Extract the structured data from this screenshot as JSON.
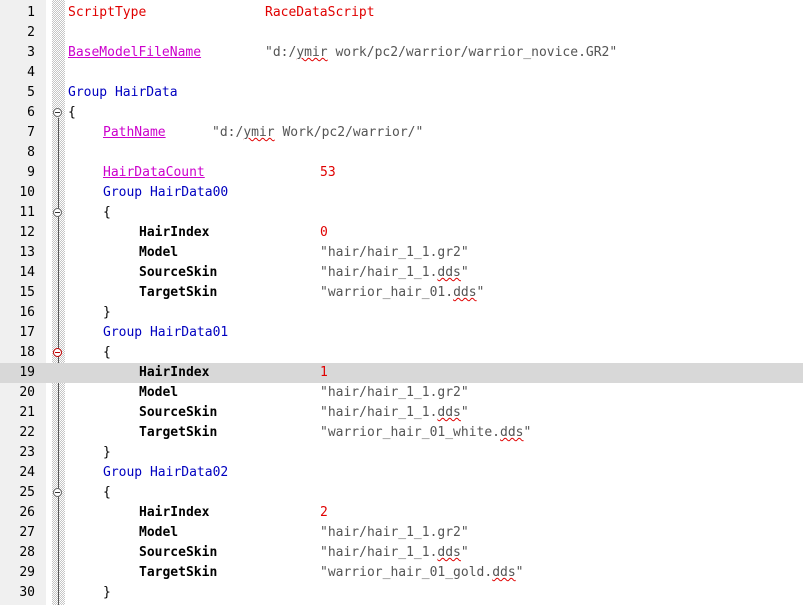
{
  "editor": {
    "lines": [
      {
        "n": "1",
        "key": "ScriptType",
        "val": "RaceDataScript"
      },
      {
        "n": "2"
      },
      {
        "n": "3",
        "key": "BaseModelFileName",
        "val_pre": "\"d:/",
        "val_sq": "ymir",
        "val_post": " work/pc2/warrior/warrior_novice.GR2\""
      },
      {
        "n": "4"
      },
      {
        "n": "5",
        "text": "Group HairData"
      },
      {
        "n": "6",
        "text": "{"
      },
      {
        "n": "7",
        "key": "PathName",
        "val_pre": "\"d:/",
        "val_sq": "ymir",
        "val_post": " Work/pc2/warrior/\""
      },
      {
        "n": "8"
      },
      {
        "n": "9",
        "key": "HairDataCount",
        "val": "53"
      },
      {
        "n": "10",
        "text": "Group HairData00"
      },
      {
        "n": "11",
        "text": "{"
      },
      {
        "n": "12",
        "key": "HairIndex",
        "val": "0"
      },
      {
        "n": "13",
        "key": "Model",
        "val": "\"hair/hair_1_1.gr2\""
      },
      {
        "n": "14",
        "key": "SourceSkin",
        "val_pre": "\"hair/hair_1_1.",
        "val_sq": "dds",
        "val_post": "\""
      },
      {
        "n": "15",
        "key": "TargetSkin",
        "val_pre": "\"warrior_hair_01.",
        "val_sq": "dds",
        "val_post": "\""
      },
      {
        "n": "16",
        "text": "}"
      },
      {
        "n": "17",
        "text": "Group HairData01"
      },
      {
        "n": "18",
        "text": "{"
      },
      {
        "n": "19",
        "key": "HairIndex",
        "val": "1"
      },
      {
        "n": "20",
        "key": "Model",
        "val": "\"hair/hair_1_1.gr2\""
      },
      {
        "n": "21",
        "key": "SourceSkin",
        "val_pre": "\"hair/hair_1_1.",
        "val_sq": "dds",
        "val_post": "\""
      },
      {
        "n": "22",
        "key": "TargetSkin",
        "val_pre": "\"warrior_hair_01_white.",
        "val_sq": "dds",
        "val_post": "\""
      },
      {
        "n": "23",
        "text": "}"
      },
      {
        "n": "24",
        "text": "Group HairData02"
      },
      {
        "n": "25",
        "text": "{"
      },
      {
        "n": "26",
        "key": "HairIndex",
        "val": "2"
      },
      {
        "n": "27",
        "key": "Model",
        "val": "\"hair/hair_1_1.gr2\""
      },
      {
        "n": "28",
        "key": "SourceSkin",
        "val_pre": "\"hair/hair_1_1.",
        "val_sq": "dds",
        "val_post": "\""
      },
      {
        "n": "29",
        "key": "TargetSkin",
        "val_pre": "\"warrior_hair_01_gold.",
        "val_sq": "dds",
        "val_post": "\""
      },
      {
        "n": "30",
        "text": "}"
      }
    ],
    "current_line": "19",
    "colors": {
      "keyword_red": "#e00000",
      "keyword_pink": "#cc00cc",
      "keyword_blue": "#0000c0",
      "string": "#555555",
      "current_line_bg": "#d8d8d8"
    },
    "icons": {
      "fold_toggle": "minus-circle-icon"
    }
  }
}
